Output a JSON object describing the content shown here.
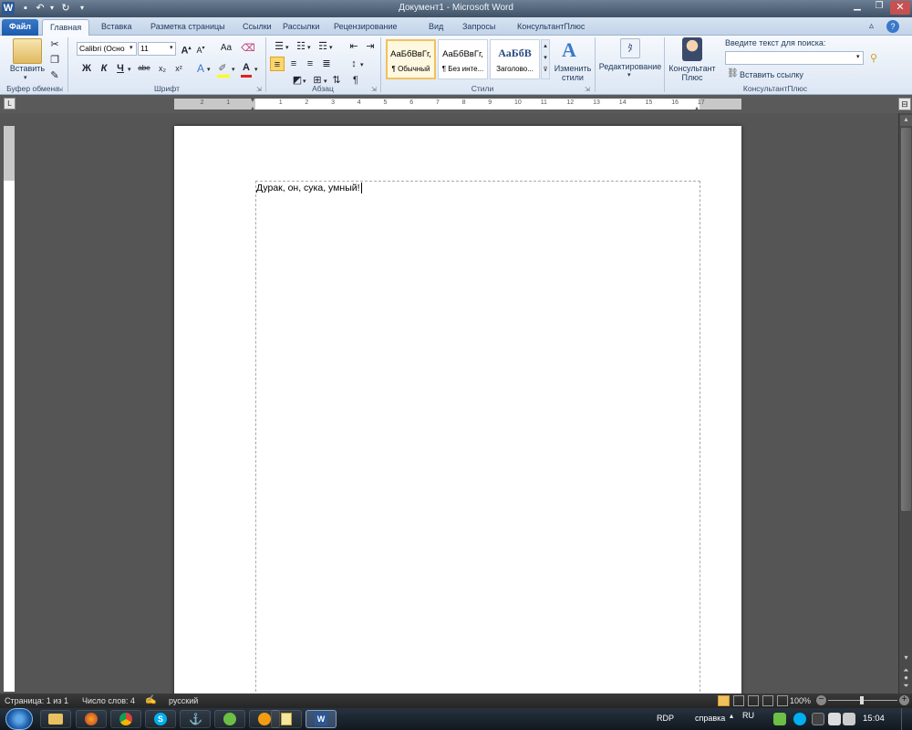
{
  "window": {
    "title": "Документ1 - Microsoft Word"
  },
  "quick_access": {
    "icons": [
      "word-icon",
      "save-icon",
      "undo-icon",
      "redo-icon",
      "customize-icon"
    ]
  },
  "tabs": [
    {
      "label": "Файл"
    },
    {
      "label": "Главная"
    },
    {
      "label": "Вставка"
    },
    {
      "label": "Разметка страницы"
    },
    {
      "label": "Ссылки"
    },
    {
      "label": "Рассылки"
    },
    {
      "label": "Рецензирование"
    },
    {
      "label": "Вид"
    },
    {
      "label": "Запросы"
    },
    {
      "label": "КонсультантПлюс"
    }
  ],
  "clipboard": {
    "paste_label": "Вставить",
    "group_label": "Буфер обмена"
  },
  "font": {
    "name": "Calibri (Осно",
    "size": "11",
    "group_label": "Шрифт",
    "aa_label": "Aa"
  },
  "font_buttons": {
    "bold": "Ж",
    "italic": "К",
    "underline": "Ч",
    "strike": "abe",
    "sub": "x₂",
    "sup": "x²"
  },
  "paragraph": {
    "group_label": "Абзац",
    "pilcrow": "¶"
  },
  "styles": {
    "group_label": "Стили",
    "items": [
      {
        "preview": "АаБбВвГг,",
        "name": "¶ Обычный"
      },
      {
        "preview": "АаБбВвГг,",
        "name": "¶ Без инте..."
      },
      {
        "preview": "АаБбВ",
        "name": "Заголово..."
      }
    ],
    "change_label_1": "Изменить",
    "change_label_2": "стили"
  },
  "editing": {
    "label": "Редактирование"
  },
  "consultant": {
    "label_1": "Консультант",
    "label_2": "Плюс",
    "search_label": "Введите текст для поиска:",
    "insert_link_label": "Вставить ссылку",
    "group_label": "КонсультантПлюс"
  },
  "ruler": {
    "numbers": [
      "2",
      "1",
      "1",
      "2",
      "3",
      "4",
      "5",
      "6",
      "7",
      "8",
      "9",
      "10",
      "11",
      "12",
      "13",
      "14",
      "15",
      "16",
      "17"
    ]
  },
  "document": {
    "text": "Дурак, он, сука, умный!"
  },
  "status": {
    "page": "Страница: 1 из 1",
    "words": "Число слов: 4",
    "language": "русский",
    "zoom": "100%"
  },
  "taskbar": {
    "tray_rdp": "RDP",
    "tray_help": "справка",
    "tray_lang": "RU",
    "clock": "15:04"
  },
  "colors": {
    "accent": "#1c5aab",
    "highlight": "#f0c15d",
    "font_color": "#e02020"
  }
}
